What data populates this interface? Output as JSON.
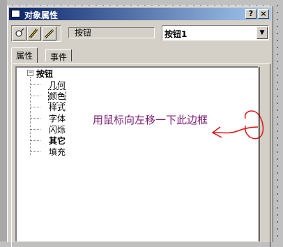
{
  "window": {
    "title": "对象属性",
    "help_btn": "?",
    "close_btn": "×"
  },
  "toolbar": {
    "icons": [
      "pin-icon",
      "pen-icon",
      "pencil-icon"
    ]
  },
  "object_type": "按钮",
  "object_select": "按钮1",
  "tabs": [
    "属性",
    "事件"
  ],
  "tree": {
    "root": "按钮",
    "items": [
      "几何",
      "颜色",
      "样式",
      "字体",
      "闪烁",
      "其它",
      "填充"
    ],
    "selected_index": 1
  },
  "annotation": "用鼠标向左移一下此边框"
}
